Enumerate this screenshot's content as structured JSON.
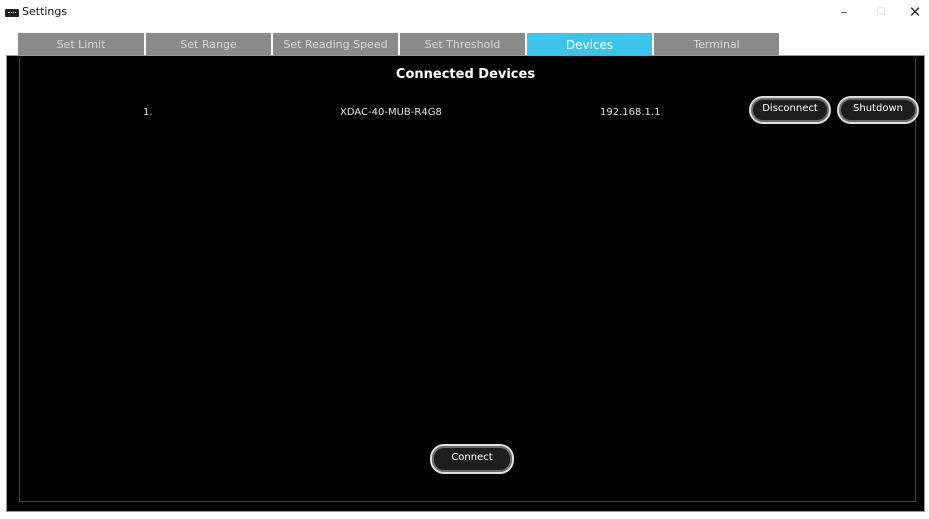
{
  "window": {
    "title": "Settings",
    "minimize_glyph": "–",
    "maximize_glyph": "☐",
    "close_glyph": "✕"
  },
  "tabs": [
    {
      "label": "Set Limit",
      "active": false
    },
    {
      "label": "Set Range",
      "active": false
    },
    {
      "label": "Set Reading Speed",
      "active": false
    },
    {
      "label": "Set Threshold",
      "active": false
    },
    {
      "label": "Devices",
      "active": true
    },
    {
      "label": "Terminal",
      "active": false
    }
  ],
  "devices": {
    "title": "Connected Devices",
    "rows": [
      {
        "index": "1.",
        "name": "XDAC-40-MUB-R4G8",
        "ip": "192.168.1.1",
        "disconnect_label": "Disconnect",
        "shutdown_label": "Shutdown"
      }
    ],
    "connect_label": "Connect"
  },
  "colors": {
    "active_tab": "#3cc5ea",
    "inactive_tab": "#8a8a8a",
    "panel_bg": "#000000"
  },
  "icons": {
    "app": "app-window-icon",
    "minimize": "minimize-icon",
    "maximize": "maximize-icon",
    "close": "close-icon"
  }
}
